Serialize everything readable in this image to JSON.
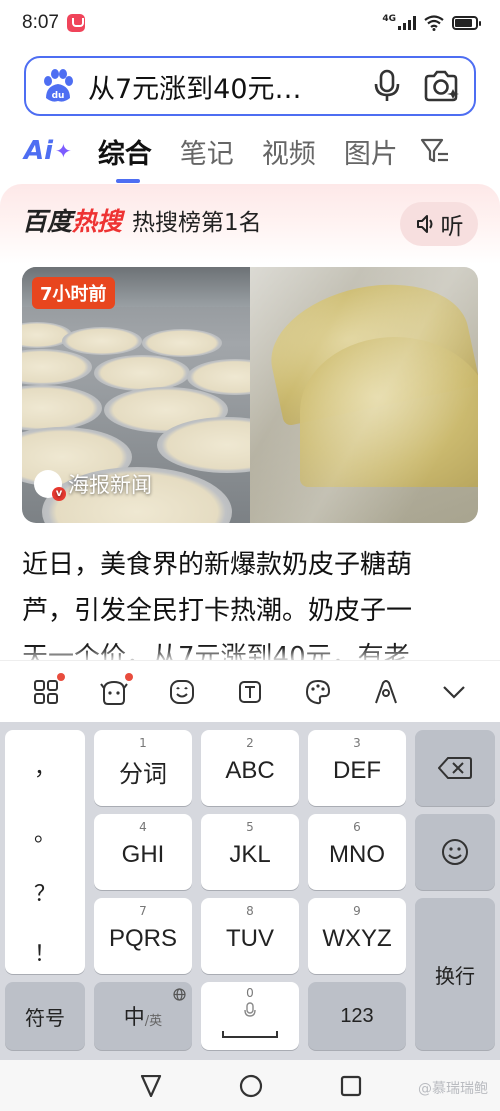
{
  "status_bar": {
    "time": "8:07",
    "network": "4G",
    "battery_percent": 85
  },
  "search": {
    "query": "从7元涨到40元…"
  },
  "tabs": {
    "ai_label": "Ai",
    "items": [
      "综合",
      "笔记",
      "视频",
      "图片"
    ],
    "active": "综合"
  },
  "hot_card": {
    "logo_a": "百度",
    "logo_b": "热搜",
    "rank_text": "热搜榜第1名",
    "listen_label": "听",
    "time_badge": "7小时前",
    "source": "海报新闻"
  },
  "article": {
    "line1": "近日，美食界的新爆款奶皮子糖葫",
    "line2": "芦，引发全民打卡热潮。奶皮子一",
    "line3": "天一个价，从7元涨到40元，有老"
  },
  "keyboard": {
    "punct": [
      "，",
      "。",
      "？",
      "！"
    ],
    "keys": [
      {
        "num": "1",
        "label": "分词"
      },
      {
        "num": "2",
        "label": "ABC"
      },
      {
        "num": "3",
        "label": "DEF"
      },
      {
        "num": "4",
        "label": "GHI"
      },
      {
        "num": "5",
        "label": "JKL"
      },
      {
        "num": "6",
        "label": "MNO"
      },
      {
        "num": "7",
        "label": "PQRS"
      },
      {
        "num": "8",
        "label": "TUV"
      },
      {
        "num": "9",
        "label": "WXYZ"
      }
    ],
    "enter_label": "换行",
    "symbol_label": "符号",
    "lang_main": "中",
    "lang_alt": "/英",
    "space_num": "0",
    "num_label": "123"
  },
  "watermark": "@慕瑞瑞鲍"
}
